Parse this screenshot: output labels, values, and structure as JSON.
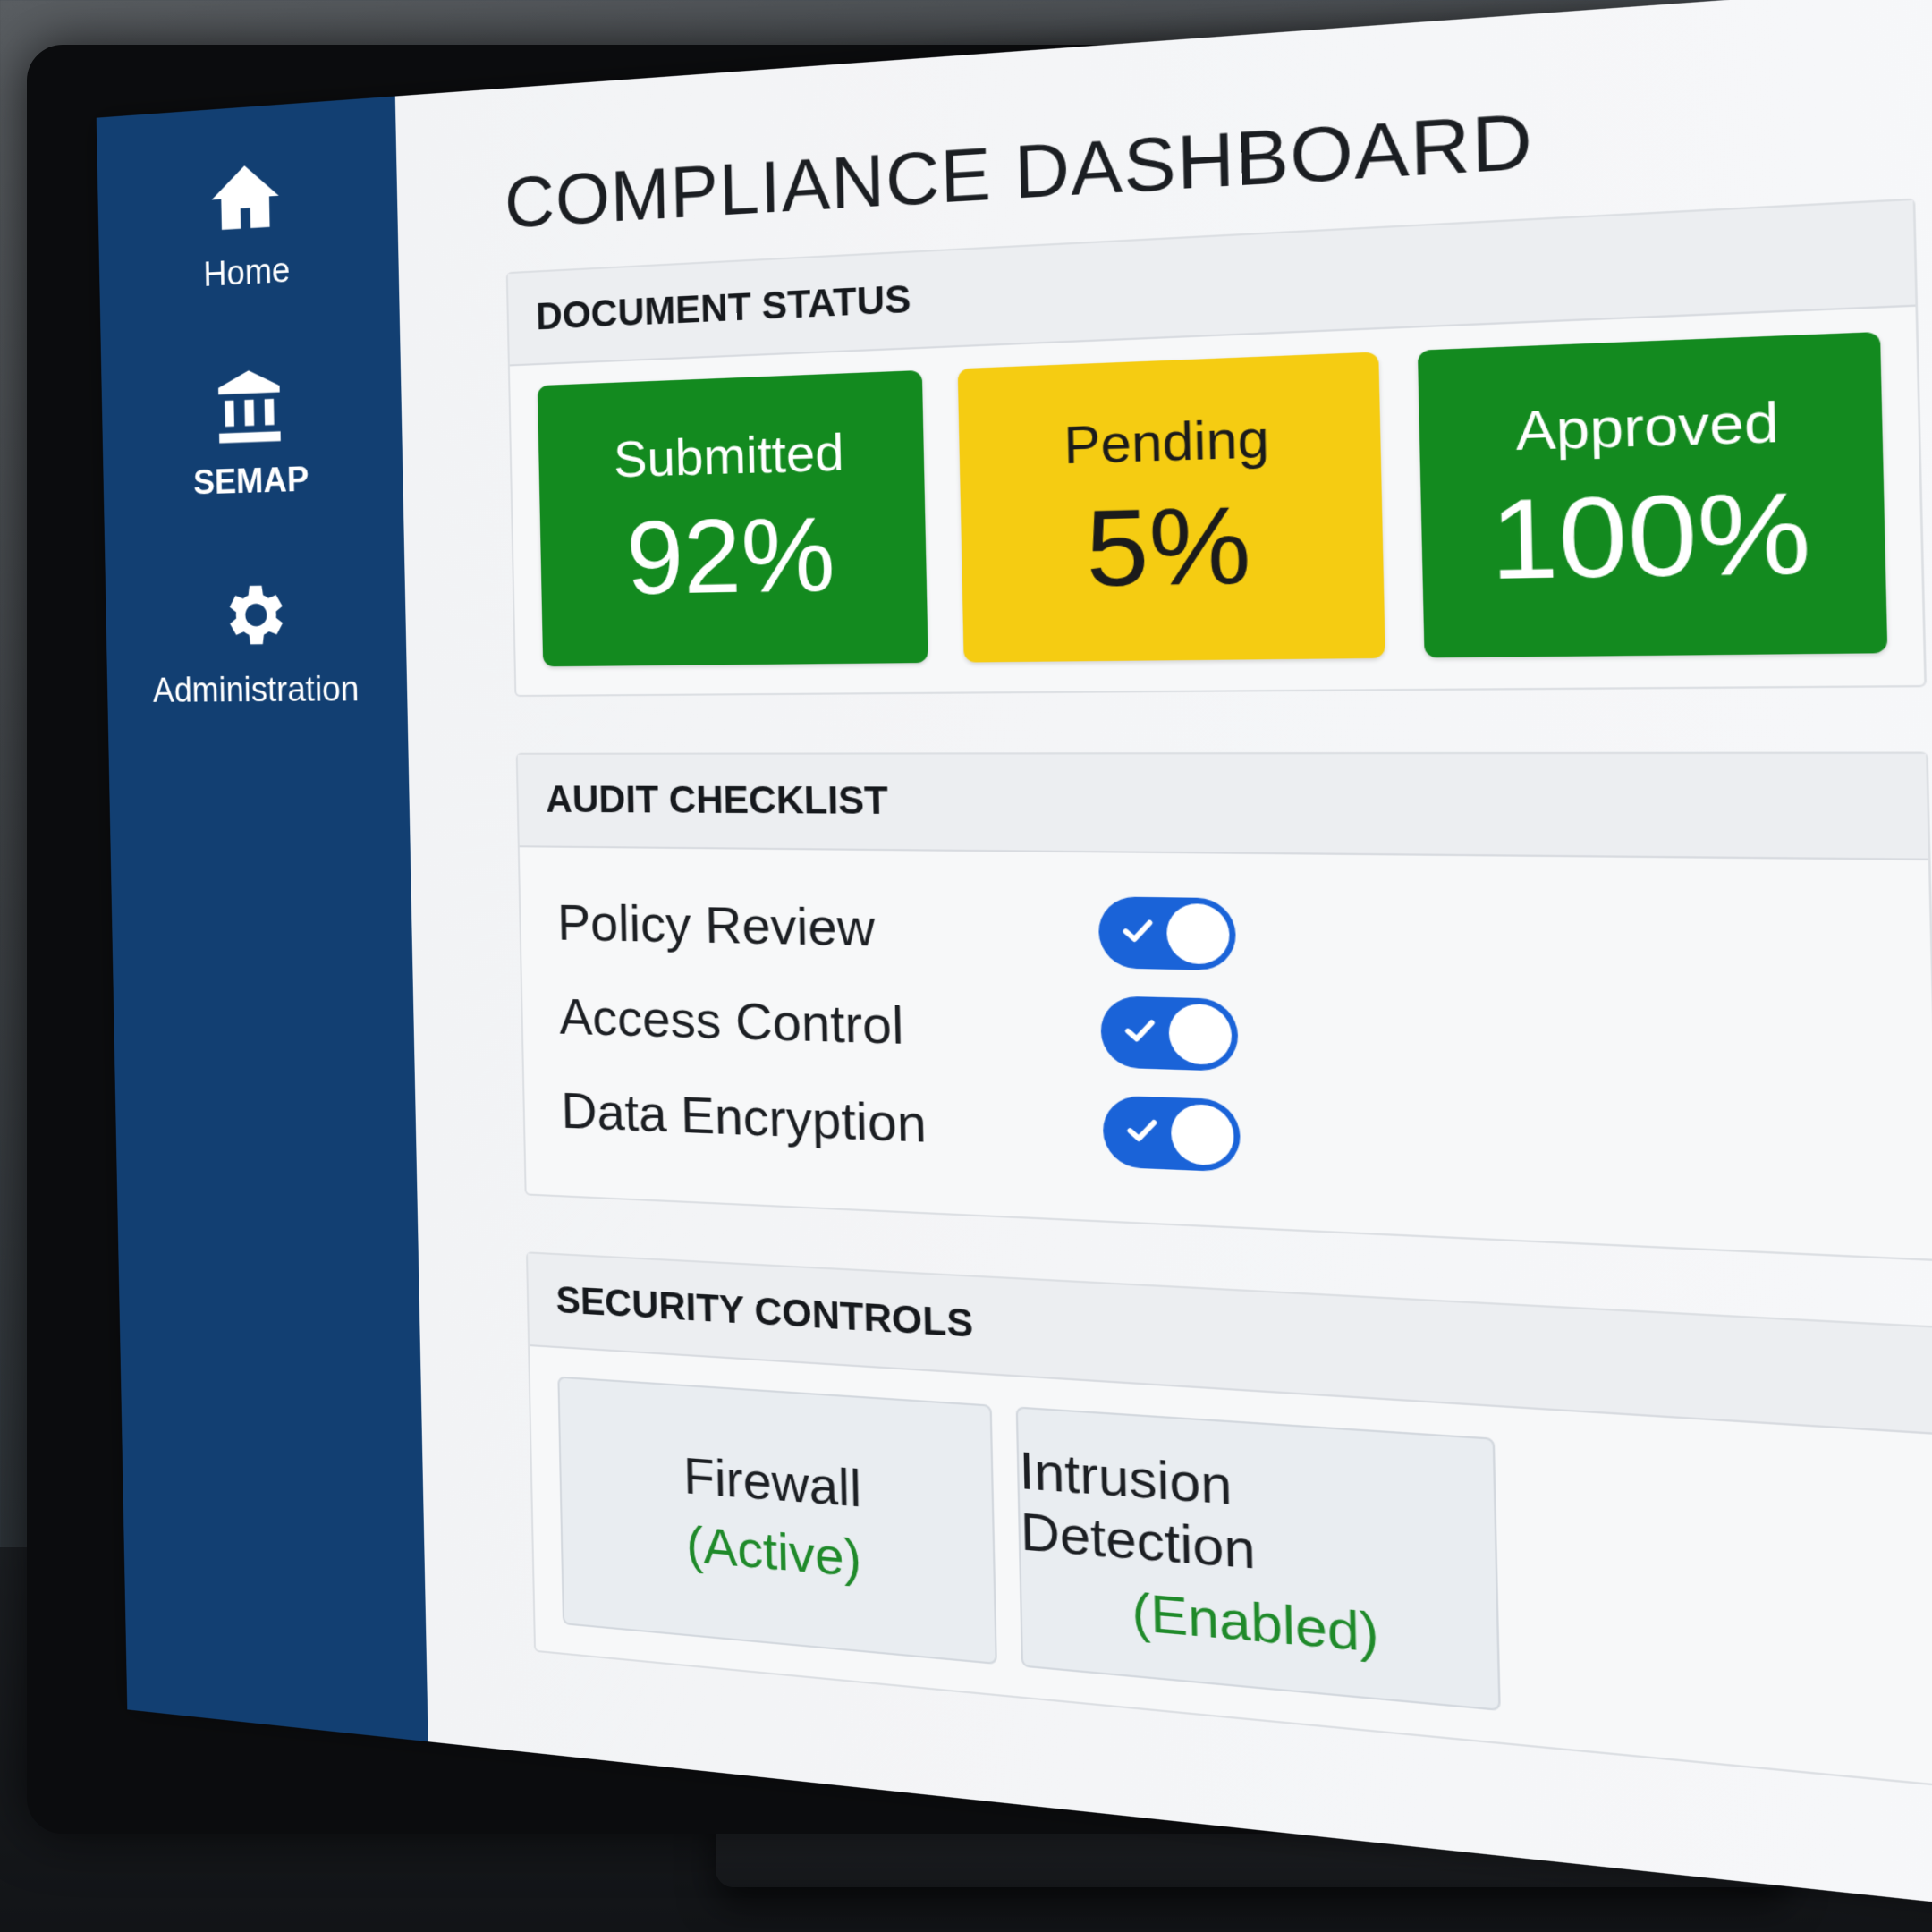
{
  "sidebar": {
    "items": [
      {
        "label": "Home",
        "icon": "home-icon"
      },
      {
        "label": "SEMAP",
        "icon": "institution-icon"
      },
      {
        "label": "Administration",
        "icon": "gear-icon"
      }
    ]
  },
  "header": {
    "title": "COMPLIANCE DASHBOARD"
  },
  "document_status": {
    "title": "DOCUMENT STATUS",
    "cards": [
      {
        "label": "Submitted",
        "value": "92%",
        "color": "#138a1f"
      },
      {
        "label": "Pending",
        "value": "5%",
        "color": "#f5cc12"
      },
      {
        "label": "Approved",
        "value": "100%",
        "color": "#138a1f"
      }
    ]
  },
  "audit_checklist": {
    "title": "AUDIT CHECKLIST",
    "items": [
      {
        "label": "Policy Review",
        "checked": true
      },
      {
        "label": "Access Control",
        "checked": true
      },
      {
        "label": "Data Encryption",
        "checked": true
      }
    ]
  },
  "security_controls": {
    "title": "SECURITY CONTROLS",
    "items": [
      {
        "name": "Firewall",
        "state": "(Active)"
      },
      {
        "name": "Intrusion Detection",
        "state": "(Enabled)"
      }
    ]
  },
  "colors": {
    "sidebar": "#123f72",
    "toggle_on": "#1a63d8",
    "success_text": "#1f8a2a"
  }
}
